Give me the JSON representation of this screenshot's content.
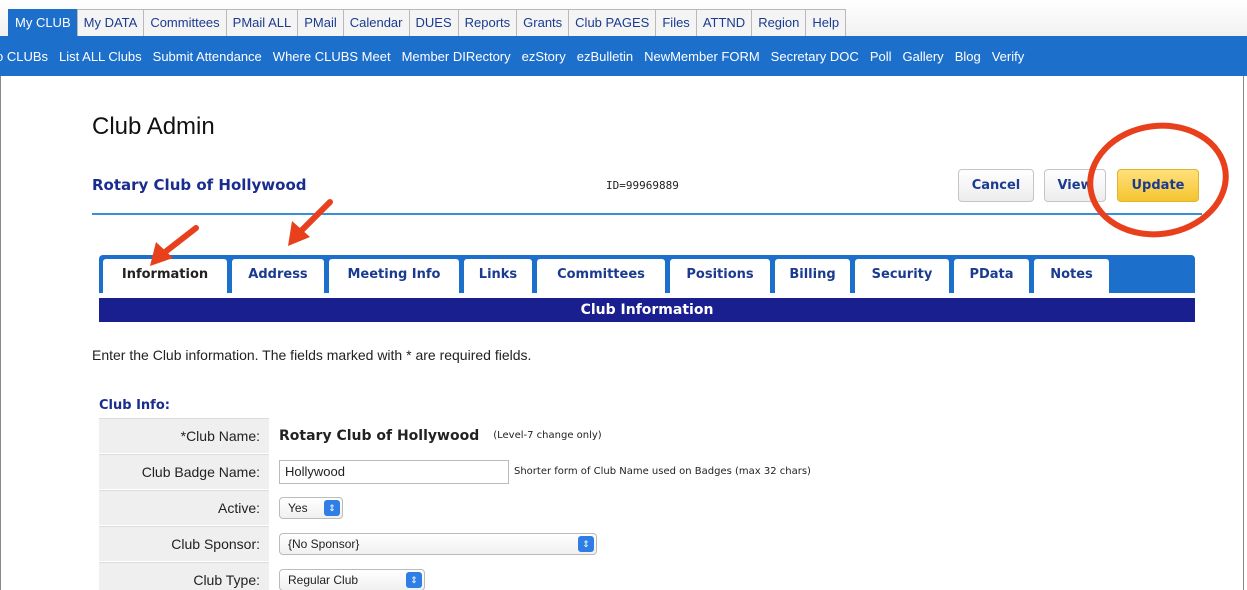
{
  "top_tabs": [
    "My CLUB",
    "My DATA",
    "Committees",
    "PMail ALL",
    "PMail",
    "Calendar",
    "DUES",
    "Reports",
    "Grants",
    "Club PAGES",
    "Files",
    "ATTND",
    "Region",
    "Help"
  ],
  "sub_nav": [
    "o CLUBs",
    "List ALL Clubs",
    "Submit Attendance",
    "Where CLUBS Meet",
    "Member DIRectory",
    "ezStory",
    "ezBulletin",
    "NewMember FORM",
    "Secretary DOC",
    "Poll",
    "Gallery",
    "Blog",
    "Verify"
  ],
  "page": {
    "title": "Club Admin",
    "club_name": "Rotary Club of Hollywood",
    "club_id": "ID=99969889"
  },
  "buttons": {
    "cancel": "Cancel",
    "view": "View",
    "update": "Update"
  },
  "tabs": [
    "Information",
    "Address",
    "Meeting Info",
    "Links",
    "Committees",
    "Positions",
    "Billing",
    "Security",
    "PData",
    "Notes"
  ],
  "section_bar": "Club Information",
  "intro": "Enter the Club information. The fields marked with * are required fields.",
  "section_heading": "Club Info:",
  "fields": {
    "club_name": {
      "label": "*Club Name:",
      "value": "Rotary Club of Hollywood",
      "note": "(Level-7 change only)"
    },
    "badge_name": {
      "label": "Club Badge Name:",
      "value": "Hollywood",
      "note": "Shorter form of Club Name used on Badges (max 32 chars)"
    },
    "active": {
      "label": "Active:",
      "value": "Yes"
    },
    "sponsor": {
      "label": "Club Sponsor:",
      "value": "{No Sponsor}"
    },
    "type": {
      "label": "Club Type:",
      "value": "Regular Club"
    }
  },
  "colors": {
    "nav_blue": "#1d6fcc",
    "bar_navy": "#1a1f8f",
    "update_yellow": "#f4c531",
    "annotation_red": "#e8401c"
  }
}
